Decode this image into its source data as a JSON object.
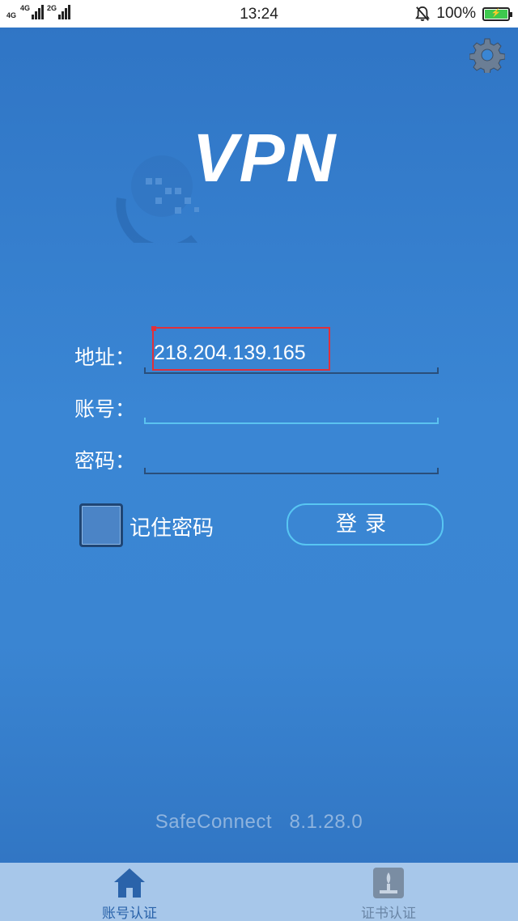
{
  "status_bar": {
    "signal_1_label": "4G",
    "signal_2_label": "4G",
    "signal_3_label": "2G",
    "time": "13:24",
    "battery_text": "100%",
    "battery_level": 1.0,
    "icons": [
      "signal-icon",
      "bell-off-icon",
      "battery-charging-icon"
    ]
  },
  "header": {
    "settings_icon": "gear-icon",
    "logo_text": "VPN"
  },
  "form": {
    "address_label": "地址：",
    "address_value": "218.204.139.165",
    "account_label": "账号：",
    "account_value": "",
    "password_label": "密码：",
    "password_value": "",
    "remember_label": "记住密码",
    "remember_checked": false,
    "login_label": "登录"
  },
  "footer": {
    "app_name": "SafeConnect",
    "version": "8.1.28.0"
  },
  "tabs": [
    {
      "label": "账号认证",
      "icon": "home-icon",
      "active": true
    },
    {
      "label": "证书认证",
      "icon": "certificate-icon",
      "active": false
    }
  ],
  "colors": {
    "background": "#3a86d4",
    "accent": "#58c6f2",
    "highlight": "#e0303a",
    "tabbar": "#a7c7ea"
  }
}
